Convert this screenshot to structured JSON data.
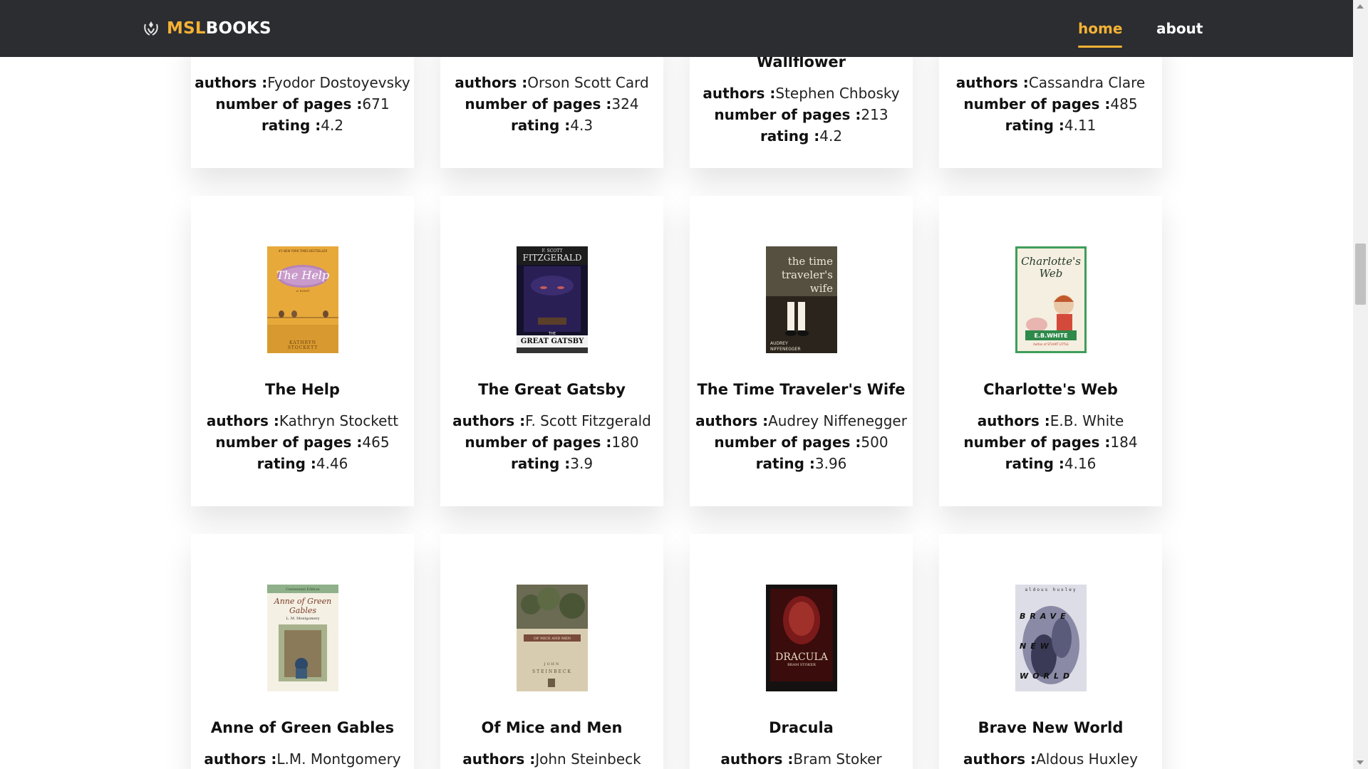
{
  "nav": {
    "logo_accent": "MSL",
    "logo_rest": "BOOKS",
    "home": "home",
    "about": "about"
  },
  "labels": {
    "authors": "authors :",
    "pages": "number of pages :",
    "rating": "rating :"
  },
  "books": [
    {
      "title": "",
      "authors": "Fyodor Dostoyevsky",
      "pages": "671",
      "rating": "4.2"
    },
    {
      "title": "",
      "authors": "Orson Scott Card",
      "pages": "324",
      "rating": "4.3"
    },
    {
      "title": "Wallflower",
      "authors": "Stephen Chbosky",
      "pages": "213",
      "rating": "4.2"
    },
    {
      "title": "",
      "authors": "Cassandra Clare",
      "pages": "485",
      "rating": "4.11"
    },
    {
      "title": "The Help",
      "authors": "Kathryn Stockett",
      "pages": "465",
      "rating": "4.46"
    },
    {
      "title": "The Great Gatsby",
      "authors": "F. Scott Fitzgerald",
      "pages": "180",
      "rating": "3.9"
    },
    {
      "title": "The Time Traveler's Wife",
      "authors": "Audrey Niffenegger",
      "pages": "500",
      "rating": "3.96"
    },
    {
      "title": "Charlotte's Web",
      "authors": "E.B. White",
      "pages": "184",
      "rating": "4.16"
    },
    {
      "title": "Anne of Green Gables",
      "authors": "L.M. Montgomery",
      "pages": "",
      "rating": ""
    },
    {
      "title": "Of Mice and Men",
      "authors": "John Steinbeck",
      "pages": "",
      "rating": ""
    },
    {
      "title": "Dracula",
      "authors": "Bram Stoker",
      "pages": "",
      "rating": ""
    },
    {
      "title": "Brave New World",
      "authors": "Aldous Huxley",
      "pages": "",
      "rating": ""
    }
  ],
  "covers": {
    "help": {
      "top": "#1 NEW YORK TIMES BESTSELLER",
      "title": "The Help",
      "sub": "a novel",
      "author1": "KATHRYN",
      "author2": "STOCKETT"
    },
    "gatsby": {
      "top1": "F. SCOTT",
      "top2": "FITZGERALD",
      "title1": "THE",
      "title2": "GREAT GATSBY"
    },
    "ttw": {
      "title1": "the time",
      "title2": "traveler's",
      "title3": "wife",
      "author1": "AUDREY",
      "author2": "NIFFENEGGER"
    },
    "charlotte": {
      "title1": "Charlotte's",
      "title2": "Web",
      "author": "E.B.WHITE",
      "sub": "Author of STUART LITTLE"
    },
    "anne": {
      "top": "Centennial Edition",
      "title1": "Anne of Green",
      "title2": "Gables",
      "author": "L. M. Montgomery"
    },
    "mice": {
      "title": "OF MICE AND MEN",
      "author1": "JOHN",
      "author2": "STEINBECK"
    },
    "dracula": {
      "title": "DRACULA",
      "author": "BRAM STOKER"
    },
    "brave": {
      "top": "aldous huxley",
      "w1": "BRAVE",
      "w2": "NEW",
      "w3": "WORLD"
    }
  },
  "colors": {
    "navbar": "#2b2d31",
    "accent": "#f5b234",
    "card_bg": "#ffffff",
    "text": "#111111"
  }
}
